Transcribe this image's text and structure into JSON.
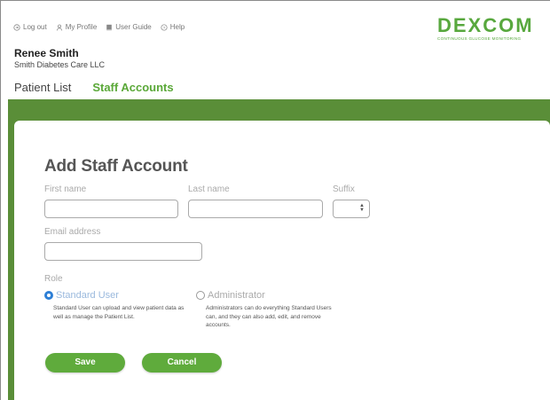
{
  "utility_links": [
    {
      "label": "Log out",
      "icon": "logout-icon"
    },
    {
      "label": "My Profile",
      "icon": "user-icon"
    },
    {
      "label": "User Guide",
      "icon": "book-icon"
    },
    {
      "label": "Help",
      "icon": "help-icon"
    }
  ],
  "brand": {
    "name": "DEXCOM",
    "tagline": "CONTINUOUS GLUCOSE MONITORING",
    "color": "#58a83e"
  },
  "user": {
    "name": "Renee Smith",
    "organization": "Smith Diabetes Care LLC"
  },
  "nav": {
    "tabs": [
      {
        "label": "Patient List",
        "active": false
      },
      {
        "label": "Staff Accounts",
        "active": true
      }
    ]
  },
  "form": {
    "title": "Add Staff Account",
    "first_name": {
      "label": "First name",
      "value": ""
    },
    "last_name": {
      "label": "Last name",
      "value": ""
    },
    "suffix": {
      "label": "Suffix",
      "value": ""
    },
    "email": {
      "label": "Email address",
      "value": ""
    },
    "role": {
      "label": "Role",
      "options": [
        {
          "label": "Standard User",
          "checked": true,
          "description": "Standard User can upload and view patient data as well as manage the Patient List."
        },
        {
          "label": "Administrator",
          "checked": false,
          "description": "Administrators can do everything Standard Users can, and they can also add, edit, and remove accounts."
        }
      ]
    },
    "save_label": "Save",
    "cancel_label": "Cancel"
  },
  "colors": {
    "accent": "#5aa838",
    "band": "#5a8e38",
    "button": "#5fab3c",
    "radio_selected": "#2d7fd6"
  }
}
